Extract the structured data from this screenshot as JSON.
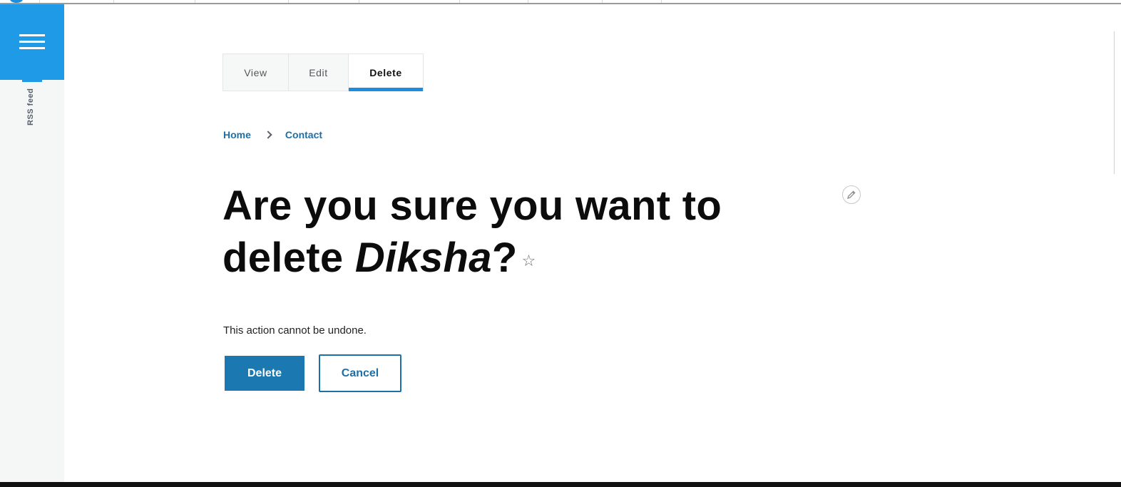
{
  "sidebar": {
    "menu_icon": "hamburger-menu-icon",
    "rss_label": "RSS feed"
  },
  "tabs": [
    {
      "label": "View",
      "active": false
    },
    {
      "label": "Edit",
      "active": false
    },
    {
      "label": "Delete",
      "active": true
    }
  ],
  "breadcrumb": {
    "items": [
      "Home",
      "Contact"
    ]
  },
  "page": {
    "title_prefix": "Are you sure you want to delete ",
    "title_name": "Diksha",
    "title_suffix": "?",
    "description": "This action cannot be undone."
  },
  "actions": {
    "delete_label": "Delete",
    "cancel_label": "Cancel"
  },
  "icons": {
    "favorite": "star-icon",
    "edit": "pencil-icon"
  },
  "colors": {
    "accent": "#1e9ae6",
    "primary_button": "#1b78b1",
    "link": "#1d6fa8"
  }
}
